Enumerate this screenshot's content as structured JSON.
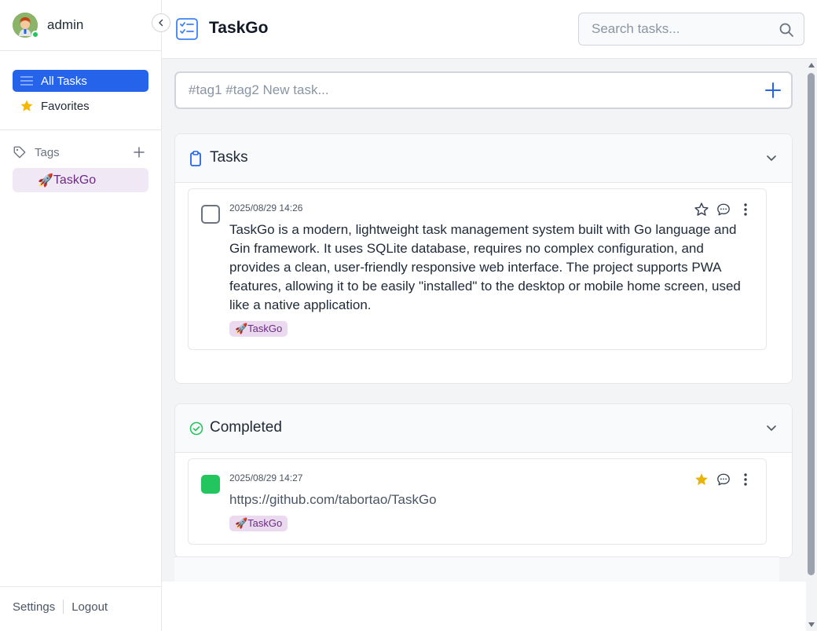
{
  "user": {
    "name": "admin",
    "status_color": "#22c55e"
  },
  "sidebar": {
    "nav": [
      {
        "label": "All Tasks",
        "icon": "list-icon",
        "active": true
      },
      {
        "label": "Favorites",
        "icon": "star-icon",
        "active": false
      }
    ],
    "tags_label": "Tags",
    "tags": [
      {
        "emoji": "🚀",
        "label": "TaskGo"
      }
    ],
    "footer": {
      "settings": "Settings",
      "logout": "Logout"
    }
  },
  "header": {
    "title": "TaskGo",
    "search_placeholder": "Search tasks..."
  },
  "new_task": {
    "placeholder": "#tag1 #tag2 New task..."
  },
  "sections": {
    "tasks": {
      "title": "Tasks",
      "items": [
        {
          "date": "2025/08/29 14:26",
          "text": "TaskGo is a modern, lightweight task management system built with Go language and Gin framework. It uses SQLite database, requires no complex configuration, and provides a clean, user-friendly responsive web interface. The project supports PWA features, allowing it to be easily \"installed\" to the desktop or mobile home screen, used like a native application.",
          "tag": "🚀TaskGo",
          "favorite": false,
          "completed": false
        }
      ]
    },
    "completed": {
      "title": "Completed",
      "items": [
        {
          "date": "2025/08/29 14:27",
          "text": "https://github.com/tabortao/TaskGo",
          "tag": "🚀TaskGo",
          "favorite": true,
          "completed": true
        }
      ]
    }
  },
  "colors": {
    "accent": "#2563eb",
    "success": "#22c55e",
    "favorite": "#eab308",
    "tag_bg": "#ead9ef",
    "tag_text": "#6b2c80"
  }
}
